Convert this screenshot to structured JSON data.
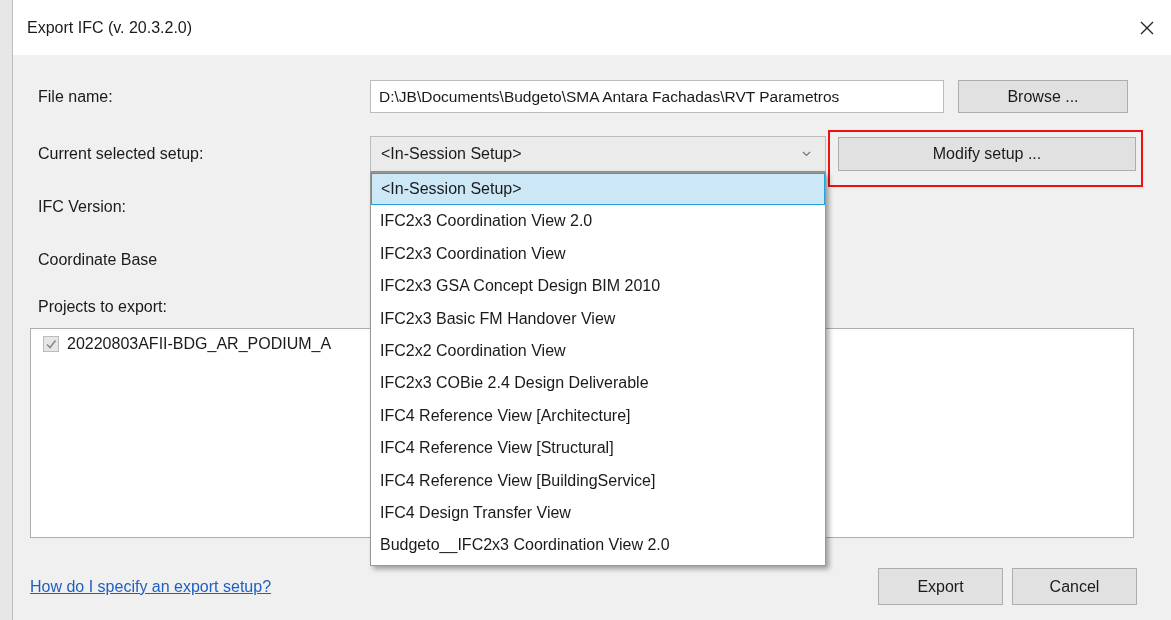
{
  "window": {
    "title": "Export IFC (v. 20.3.2.0)"
  },
  "file_name": {
    "label": "File name:",
    "value": "D:\\JB\\Documents\\Budgeto\\SMA Antara Fachadas\\RVT Parametros",
    "button": "Browse ..."
  },
  "setup": {
    "label": "Current selected setup:",
    "value": "<In-Session Setup>",
    "expanded": true,
    "button": "Modify setup ...",
    "button_highlighted": true,
    "options": [
      {
        "label": "<In-Session Setup>",
        "selected": true
      },
      {
        "label": "IFC2x3 Coordination View 2.0",
        "selected": false
      },
      {
        "label": "IFC2x3 Coordination View",
        "selected": false
      },
      {
        "label": "IFC2x3 GSA Concept Design BIM 2010",
        "selected": false
      },
      {
        "label": "IFC2x3 Basic FM Handover View",
        "selected": false
      },
      {
        "label": "IFC2x2 Coordination View",
        "selected": false
      },
      {
        "label": "IFC2x3 COBie 2.4 Design Deliverable",
        "selected": false
      },
      {
        "label": "IFC4 Reference View [Architecture]",
        "selected": false
      },
      {
        "label": "IFC4 Reference View [Structural]",
        "selected": false
      },
      {
        "label": "IFC4 Reference View [BuildingService]",
        "selected": false
      },
      {
        "label": "IFC4 Design Transfer View",
        "selected": false
      },
      {
        "label": "Budgeto__IFC2x3 Coordination View 2.0",
        "selected": false
      }
    ]
  },
  "ifc_version": {
    "label": "IFC Version:"
  },
  "coordinate_base": {
    "label": "Coordinate Base"
  },
  "projects": {
    "label": "Projects to export:",
    "items": [
      {
        "name": "20220803AFII-BDG_AR_PODIUM_A",
        "checked": true,
        "disabled": true
      }
    ]
  },
  "help_link": "How do I specify an export setup?",
  "buttons": [
    "Export",
    "Cancel"
  ]
}
